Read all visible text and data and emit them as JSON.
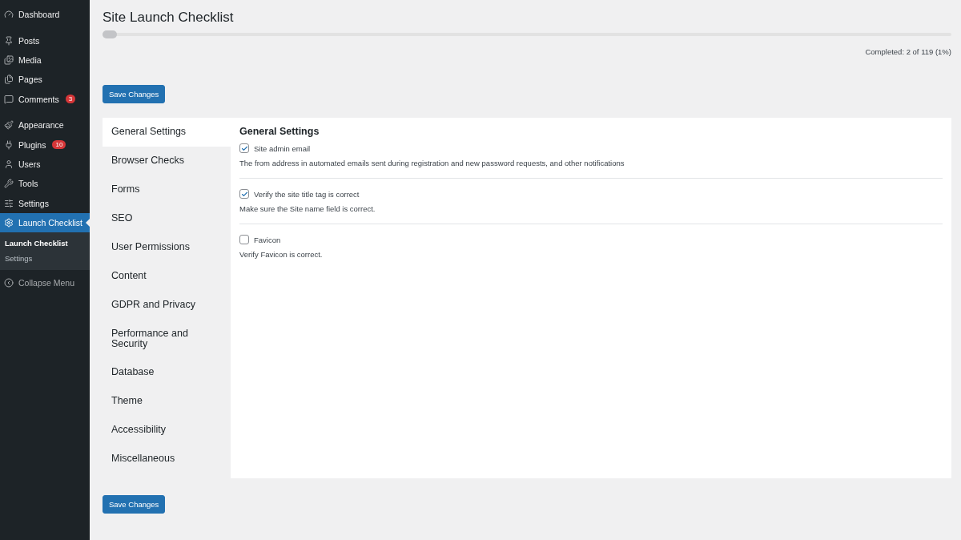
{
  "sidebar": {
    "items": [
      {
        "kind": "item",
        "label": "Dashboard",
        "selected": false
      },
      {
        "kind": "separator"
      },
      {
        "kind": "item",
        "label": "Posts",
        "selected": false
      },
      {
        "kind": "item",
        "label": "Media",
        "selected": false
      },
      {
        "kind": "item",
        "label": "Pages",
        "selected": false
      },
      {
        "kind": "item",
        "label": "Comments",
        "badge": "3",
        "selected": false
      },
      {
        "kind": "separator"
      },
      {
        "kind": "item",
        "label": "Appearance",
        "selected": false
      },
      {
        "kind": "item",
        "label": "Plugins",
        "badge": "10",
        "selected": false
      },
      {
        "kind": "item",
        "label": "Users",
        "selected": false
      },
      {
        "kind": "item",
        "label": "Tools",
        "selected": false
      },
      {
        "kind": "item",
        "label": "Settings",
        "selected": false
      },
      {
        "kind": "item",
        "label": "Launch Checklist",
        "selected": true,
        "children": [
          {
            "label": "Launch Checklist",
            "selected": true
          },
          {
            "label": "Settings",
            "selected": false
          }
        ]
      },
      {
        "kind": "collapse",
        "label": "Collapse Menu"
      }
    ]
  },
  "page": {
    "title": "Site Launch Checklist",
    "progress": {
      "level": 0.017
    },
    "completed": "Completed: 2 of 119 (1%)",
    "save_button": "Save Changes",
    "tabs": [
      {
        "label": "General Settings",
        "selected": true
      },
      {
        "label": "Browser Checks",
        "selected": false
      },
      {
        "label": "Forms",
        "selected": false
      },
      {
        "label": "SEO",
        "selected": false
      },
      {
        "label": "User Permissions",
        "selected": false
      },
      {
        "label": "Content",
        "selected": false
      },
      {
        "label": "GDPR and Privacy",
        "selected": false
      },
      {
        "label": "Performance and Security",
        "selected": false
      },
      {
        "label": "Database",
        "selected": false
      },
      {
        "label": "Theme",
        "selected": false
      },
      {
        "label": "Accessibility",
        "selected": false
      },
      {
        "label": "Miscellaneous",
        "selected": false
      }
    ],
    "section": {
      "heading": "General Settings",
      "items": [
        {
          "label": "Site admin email",
          "checked": true,
          "description": "The from address in automated emails sent during registration and new password requests, and other notifications"
        },
        {
          "label": "Verify the site title tag is correct",
          "checked": true,
          "description": "Make sure the Site name field is correct."
        },
        {
          "label": "Favicon",
          "checked": false,
          "description": "Verify Favicon is correct."
        }
      ]
    },
    "save_button_bottom": "Save Changes"
  }
}
